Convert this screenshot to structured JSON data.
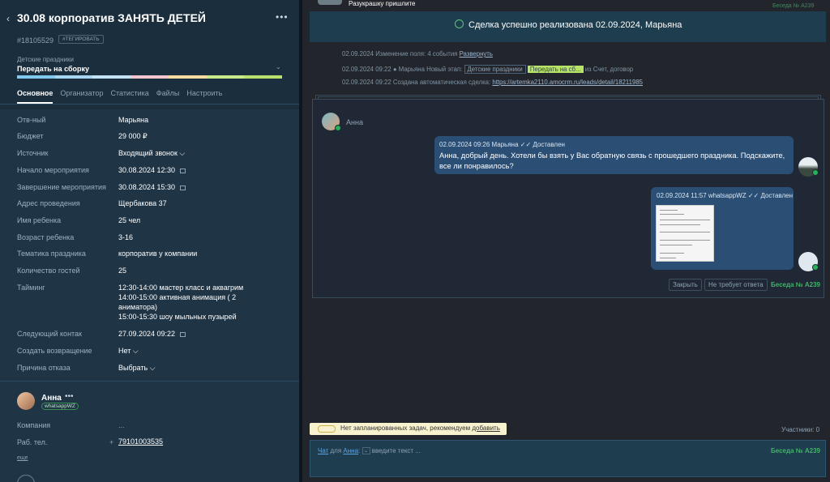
{
  "lead": {
    "title": "30.08 корпоратив ЗАНЯТЬ ДЕТЕЙ",
    "id": "#18105529",
    "tag_button": "#ТЕГИРОВАТЬ",
    "pipeline": "Детские праздники",
    "stage": "Передать на сборку",
    "stage_colors": [
      "#82c9f0",
      "#a7d6f3",
      "#c4e2f6",
      "#f3c6cf",
      "#f7dca2",
      "#c9ea8b",
      "#b6e26c"
    ]
  },
  "tabs": [
    "Основное",
    "Организатор",
    "Статистика",
    "Файлы",
    "Настроить"
  ],
  "fields": [
    {
      "label": "Отв-ный",
      "value": "Марьяна"
    },
    {
      "label": "Бюджет",
      "value": "29 000 ₽"
    },
    {
      "label": "Источник",
      "value": "Входящий звонок ⌵"
    },
    {
      "label": "Начало мероприятия",
      "value": "30.08.2024 12:30"
    },
    {
      "label": "Завершение мероприятия",
      "value": "30.08.2024 15:30"
    },
    {
      "label": "Адрес проведения",
      "value": "Щербакова 37"
    },
    {
      "label": "Имя ребенка",
      "value": "25 чел"
    },
    {
      "label": "Возраст ребенка",
      "value": "3-16"
    },
    {
      "label": "Тематика праздника",
      "value": "корпоратив у компании"
    },
    {
      "label": "Количество гостей",
      "value": "25"
    },
    {
      "label": "Тайминг",
      "value": ""
    },
    {
      "label": "Следующий контак",
      "value": "27.09.2024 09:22"
    },
    {
      "label": "Создать возвращение",
      "value": "Нет ⌵"
    },
    {
      "label": "Причина отказа",
      "value": "Выбрать ⌵"
    }
  ],
  "timing_lines": [
    "12:30-14:00 мастер класс и аквагрим",
    "14:00-15:00 активная анимация ( 2",
    "аниматора)",
    "15:00-15:30 шоу мыльных пузырей"
  ],
  "contact": {
    "name": "Анна",
    "badge": "whatsappWZ",
    "company_label": "Компания",
    "company_value": "...",
    "phone_label": "Раб. тел.",
    "phone": "79101003535",
    "more": "еще"
  },
  "feed": {
    "top_clip": "Разукрашку пришлите",
    "top_beseda": "Беседа № A239",
    "success": "Сделка успешно реализована 02.09.2024, Марьяна",
    "log1_text": "02.09.2024 Изменение поля: 4 события",
    "log1_link": "Развернуть",
    "log2_text": "02.09.2024 09:22 ● Марьяна Новый этап:",
    "log2_chip1": "Детские праздники",
    "log2_chip2": "Передать на сб...",
    "log2_tail": "из Счет, договор",
    "log3_text": "02.09.2024 09:22 Создана автоматическая сделка:",
    "log3_link": "https://artemka2110.amocrm.ru/leads/detail/18211985"
  },
  "chat": {
    "contact": "Анна",
    "msg1_header": "02.09.2024 09:26 Марьяна ✓✓ Доставлен",
    "msg1_text": "Анна, добрый день. Хотели бы взять у Вас обратную связь с прошедшего праздника. Подскажите, все ли понравилось?",
    "msg2_header": "02.09.2024 11:57 whatsappWZ ✓✓ Доставлен",
    "close_btn": "Закрыть",
    "noreply_btn": "Не требует ответа",
    "beseda": "Беседа № A239"
  },
  "footer": {
    "hint_text": "Нет запланированных задач, рекомендуем",
    "hint_link": "добавить",
    "participants": "Участники: 0",
    "compose_chat": "Чат",
    "compose_for": "для",
    "compose_contact": "Анна",
    "compose_placeholder": "введите текст ...",
    "compose_beseda": "Беседа № A239"
  }
}
